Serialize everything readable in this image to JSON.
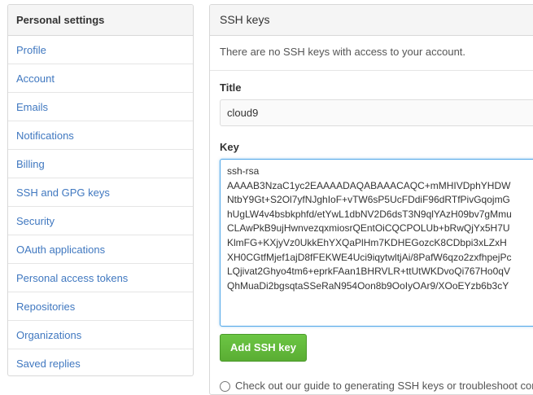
{
  "sidebar": {
    "title": "Personal settings",
    "items": [
      {
        "label": "Profile"
      },
      {
        "label": "Account"
      },
      {
        "label": "Emails"
      },
      {
        "label": "Notifications"
      },
      {
        "label": "Billing"
      },
      {
        "label": "SSH and GPG keys"
      },
      {
        "label": "Security"
      },
      {
        "label": "OAuth applications"
      },
      {
        "label": "Personal access tokens"
      },
      {
        "label": "Repositories"
      },
      {
        "label": "Organizations"
      },
      {
        "label": "Saved replies"
      }
    ]
  },
  "panel": {
    "title": "SSH keys",
    "empty_message": "There are no SSH keys with access to your account.",
    "title_label": "Title",
    "title_value": "cloud9",
    "key_label": "Key",
    "key_value": "ssh-rsa\nAAAAB3NzaC1yc2EAAAADAQABAAACAQC+mMHIVDphYHDW\nNtbY9Gt+S2Ol7yfNJghIoF+vTW6sP5UcFDdiF96dRTfPivGqojmG\nhUgLW4v4bsbkphfd/etYwL1dbNV2D6dsT3N9qlYAzH09bv7gMmu\nCLAwPkB9ujHwnvezqxmiosrQEntOiCQCPOLUb+bRwQjYx5H7U\nKlmFG+KXjyVz0UkkEhYXQaPlHm7KDHEGozcK8CDbpi3xLZxH\nXH0CGtfMjef1ajD8fFEKWE4Uci9iqytwltjAi/8PafW6qzo2zxfhpejPc\nLQjivat2Ghyo4tm6+eprkFAan1BHRVLR+ttUtWKDvoQi767Ho0qV\nQhMuaDi2bgsqtaSSeRaN954Oon8b9OoIyOAr9/XOoEYzb6b3cY",
    "add_button_label": "Add SSH key",
    "footer_text": "Check out our guide to generating SSH keys or troubleshoot common SSH Problems.",
    "footer_link": "generating SSH keys"
  }
}
